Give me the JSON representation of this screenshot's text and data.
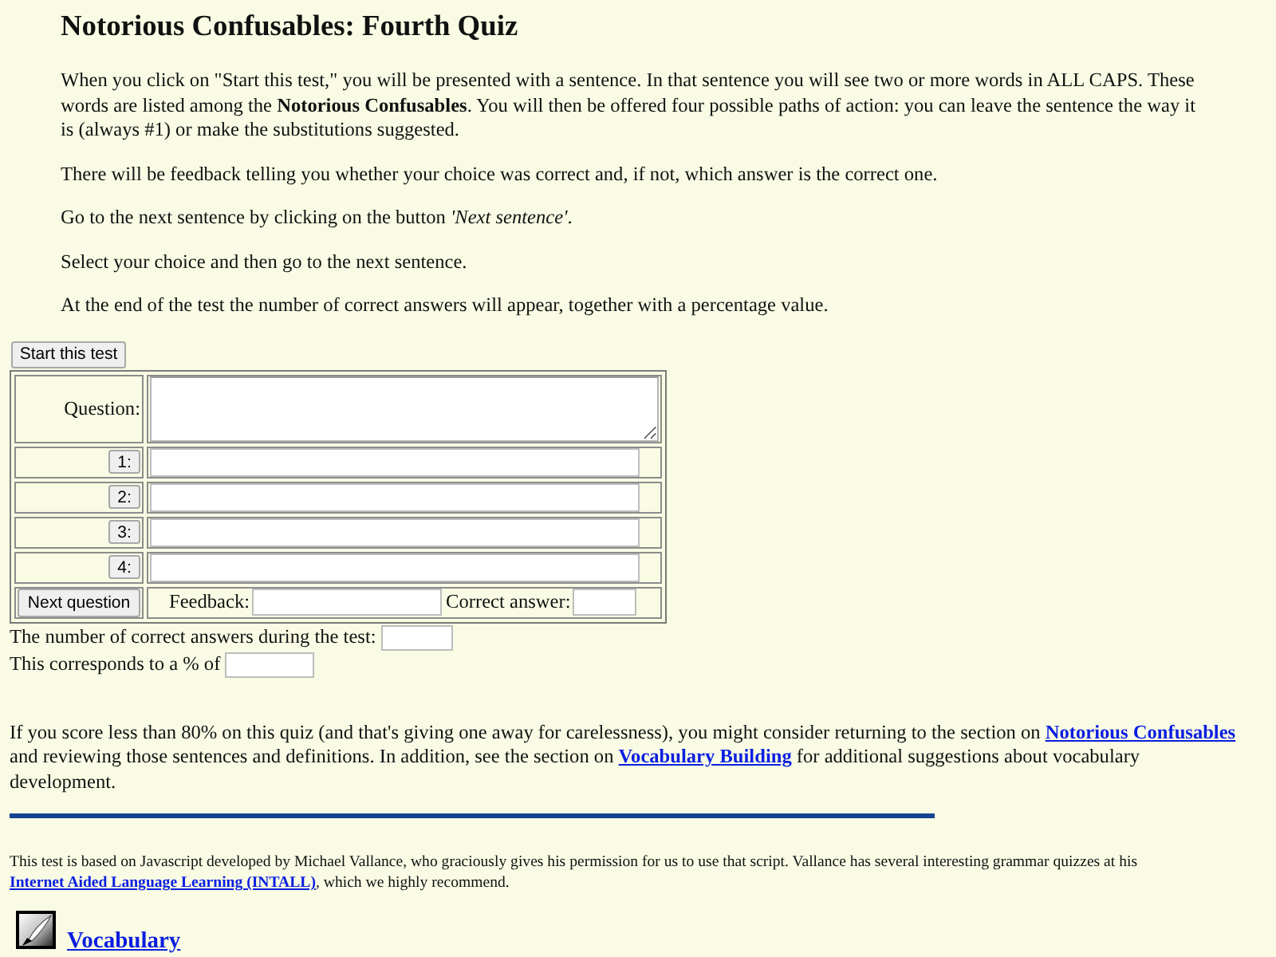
{
  "page": {
    "title": "Notorious Confusables: Fourth Quiz"
  },
  "intro": [
    "When you click on \"Start this test,\" you will be presented with a sentence. In that sentence you will see two or more words in ALL CAPS. These words are listed among the **Notorious Confusables**. You will then be offered four possible paths of action: you can leave the sentence the way it is (always #1) or make the substitutions suggested.",
    "There will be feedback telling you whether your choice was correct and, if not, which answer is the correct one.",
    "Go to the next sentence by clicking on the button *'Next sentence'*.",
    "Select your choice and then go to the next sentence.",
    "At the end of the test the number of correct answers will appear, together with a percentage value."
  ],
  "quiz": {
    "start_button": "Start this test",
    "question_label": "Question:",
    "answers": [
      {
        "label": "1:"
      },
      {
        "label": "2:"
      },
      {
        "label": "3:"
      },
      {
        "label": "4:"
      }
    ],
    "next_button": "Next question",
    "feedback_label": "Feedback:",
    "correct_answer_label": "Correct answer:"
  },
  "results": [
    {
      "label": "The number of correct answers during the test:"
    },
    {
      "label": "This corresponds to a % of"
    }
  ],
  "advice": [
    {
      "kind": "text",
      "text": "If you score less than 80% on this quiz (and that's giving one away for carelessness), you might consider returning to the section on "
    },
    {
      "kind": "link",
      "text": "Notorious Confusables"
    },
    {
      "kind": "text",
      "text": " and reviewing those sentences and definitions. In addition, see the section on "
    },
    {
      "kind": "link",
      "text": "Vocabulary Building"
    },
    {
      "kind": "text",
      "text": " for additional suggestions about vocabulary development."
    }
  ],
  "credit": [
    {
      "kind": "text",
      "text": "This test is based on Javascript developed by Michael Vallance, who graciously gives his permission for us to use that script. Vallance has several interesting grammar quizzes at his "
    },
    {
      "kind": "link",
      "text": "Internet Aided Language Learning (INTALL)"
    },
    {
      "kind": "text",
      "text": ", which we highly recommend."
    }
  ],
  "footer_link": {
    "text": "Vocabulary"
  }
}
